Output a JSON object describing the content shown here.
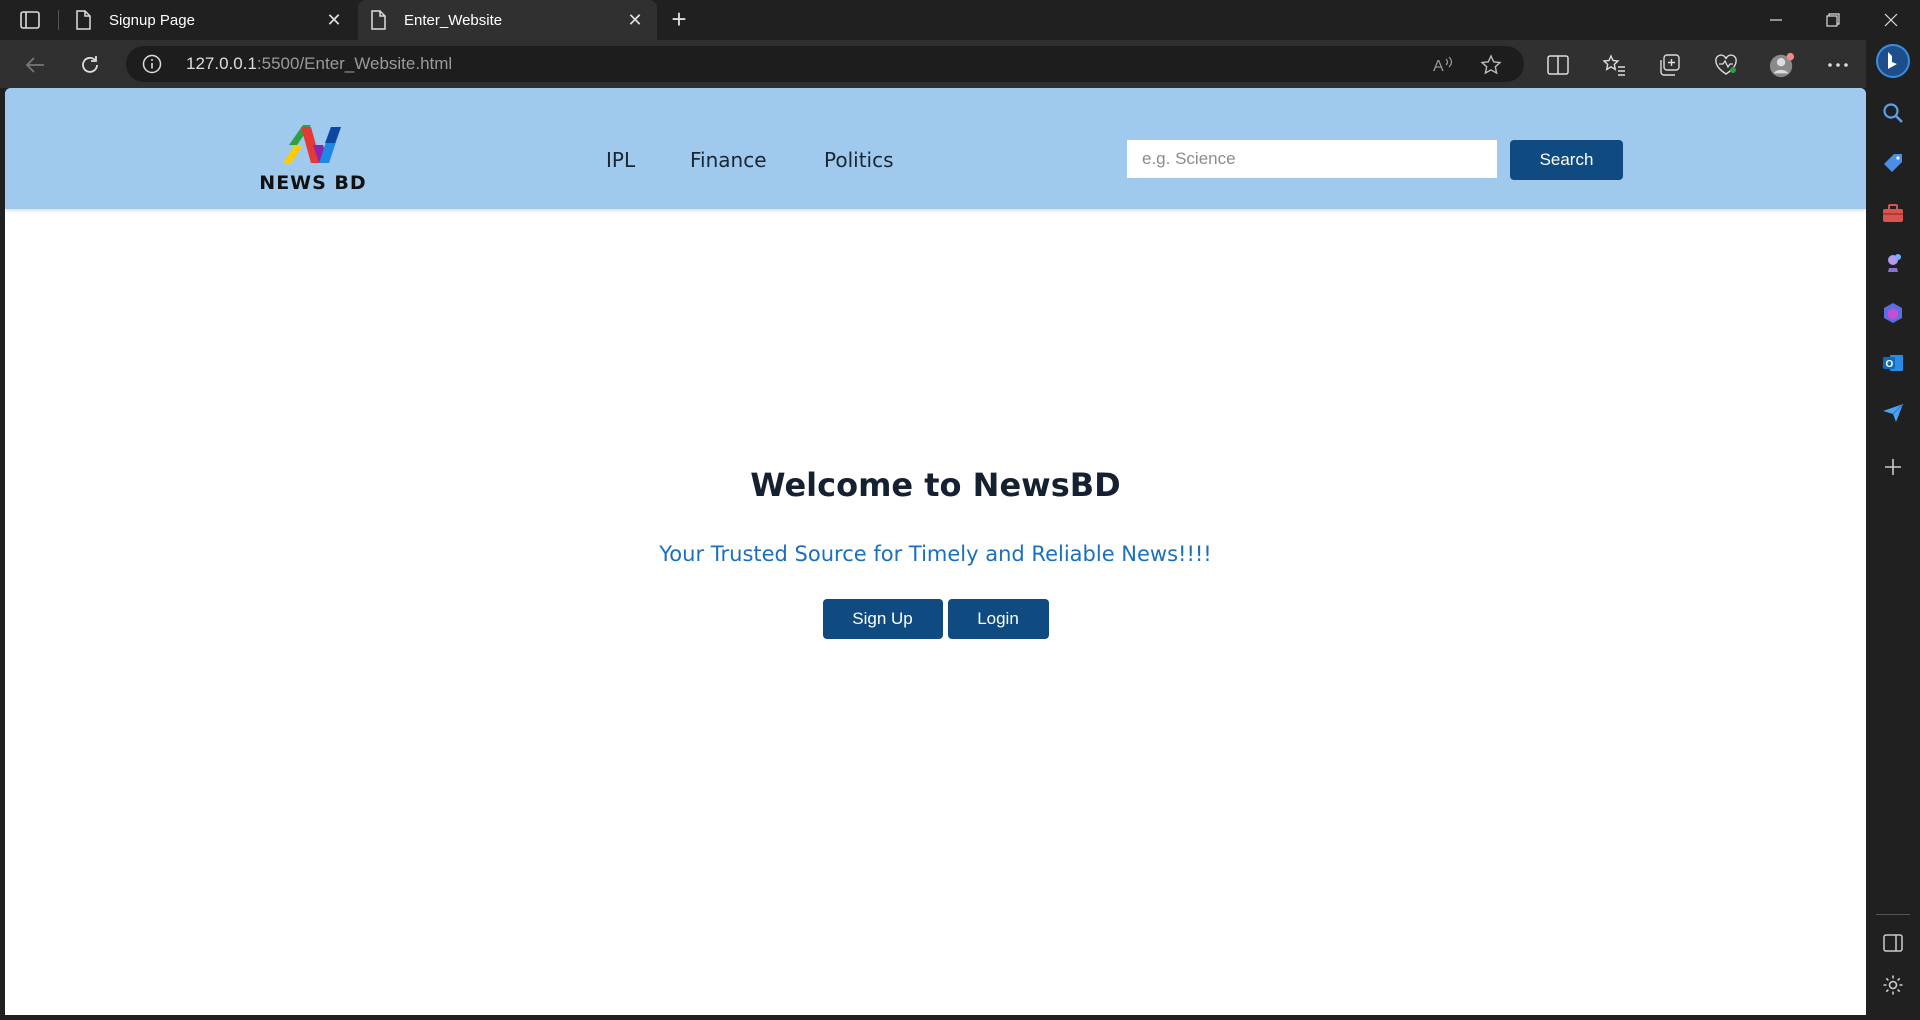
{
  "browser": {
    "tabs": [
      {
        "title": "Signup Page",
        "active": false
      },
      {
        "title": "Enter_Website",
        "active": true
      }
    ],
    "url_host": "127.0.0.1",
    "url_rest": ":5500/Enter_Website.html"
  },
  "site": {
    "logo_text": "NEWS BD",
    "nav": [
      "IPL",
      "Finance",
      "Politics"
    ],
    "search_placeholder": "e.g. Science",
    "search_label": "Search",
    "welcome": "Welcome to NewsBD",
    "tagline": "Your Trusted Source for Timely and Reliable News!!!!",
    "signup_label": "Sign Up",
    "login_label": "Login"
  },
  "colors": {
    "header_bg": "#9fcaee",
    "button_bg": "#0f4b80",
    "tagline": "#1a6fbe"
  }
}
